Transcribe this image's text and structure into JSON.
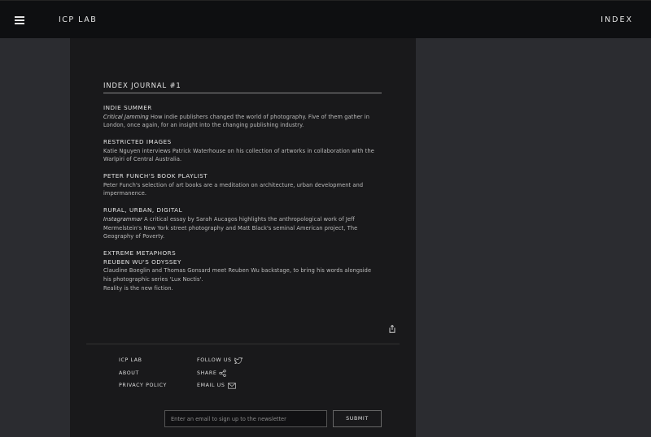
{
  "header": {
    "brand": "ICP LAB",
    "index_label": "INDEX"
  },
  "journal": {
    "title": "INDEX JOURNAL #1",
    "articles": [
      {
        "title": "INDIE SUMMER",
        "lead": "Critical Jamming",
        "body": " How indie publishers changed the world of photography. Five of them gather in London, once again, for an insight into the changing publishing industry."
      },
      {
        "title": "RESTRICTED IMAGES",
        "body": "Katie Nguyen interviews Patrick Waterhouse on his collection of artworks in collaboration with the Warlpiri of Central Australia."
      },
      {
        "title": "PETER FUNCH'S BOOK PLAYLIST",
        "body": "Peter Funch's selection of art books are a meditation on architecture, urban development and impermanence."
      },
      {
        "title": "RURAL, URBAN, DIGITAL",
        "lead": "Instagrammar",
        "body": " A critical essay by Sarah Aucagos highlights the anthropological work of Jeff Mermelstein's New York street photography and Matt Black's seminal American project, The Geography of Poverty."
      },
      {
        "title": "EXTREME METAPHORS",
        "title2": "REUBEN WU'S ODYSSEY",
        "body": "Claudine Boeglin and Thomas Gonsard meet Reuben Wu backstage, to bring his words alongside his photographic series 'Lux Noctis'.",
        "body2": "Reality is the new fiction."
      }
    ]
  },
  "footer": {
    "links_left": [
      "ICP LAB",
      "ABOUT",
      "PRIVACY POLICY"
    ],
    "follow_label": "FOLLOW US",
    "share_label": "SHARE",
    "email_label": "EMAIL US",
    "newsletter_placeholder": "Enter an email to sign up to the newsletter",
    "submit_label": "SUBMIT"
  }
}
